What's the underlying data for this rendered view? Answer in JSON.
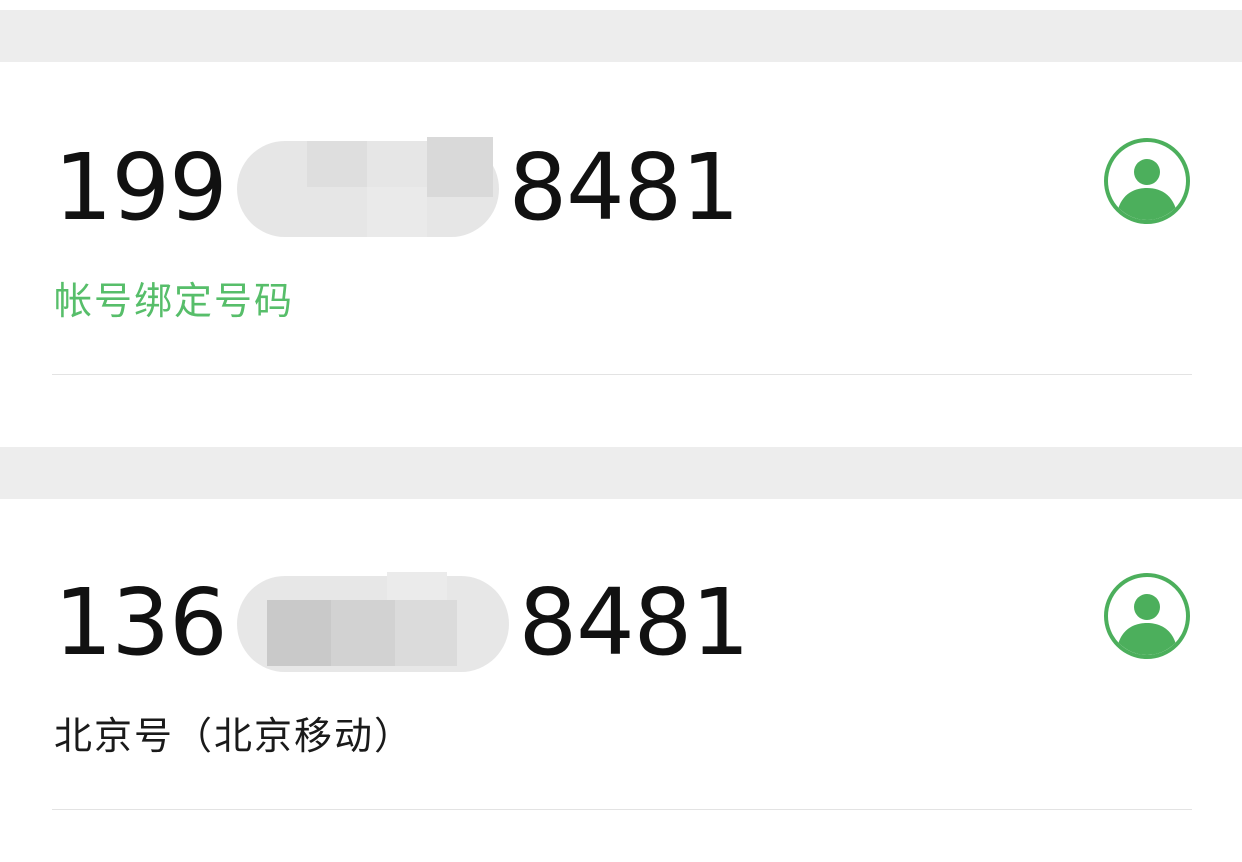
{
  "contacts": [
    {
      "number_prefix": "199",
      "number_suffix": "8481",
      "subtitle": "帐号绑定号码",
      "subtitle_color": "#57be6a",
      "icon": "contact-avatar-icon",
      "masked": true
    },
    {
      "number_prefix": "136",
      "number_suffix": "8481",
      "subtitle": "北京号（北京移动）",
      "subtitle_color": "#1a1a1a",
      "icon": "contact-avatar-icon",
      "masked": true
    }
  ],
  "colors": {
    "accent_green": "#4caf5c",
    "section_gap": "#ededed",
    "divider": "#e3e3e3"
  }
}
